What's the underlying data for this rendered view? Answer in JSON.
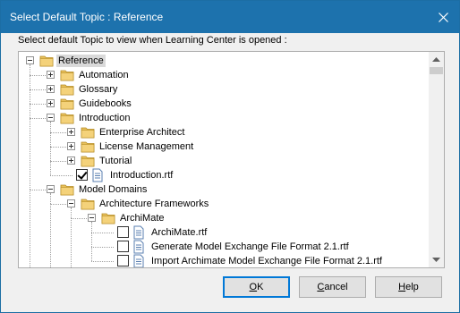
{
  "window": {
    "title": "Select Default Topic : Reference",
    "instruction": "Select default Topic to view when Learning Center is opened :"
  },
  "tree": {
    "items": [
      {
        "label": "Reference",
        "type": "folder",
        "level": 0,
        "expander": "minus",
        "selected": true
      },
      {
        "label": "Automation",
        "type": "folder",
        "level": 1,
        "expander": "plus"
      },
      {
        "label": "Glossary",
        "type": "folder",
        "level": 1,
        "expander": "plus"
      },
      {
        "label": "Guidebooks",
        "type": "folder",
        "level": 1,
        "expander": "plus"
      },
      {
        "label": "Introduction",
        "type": "folder",
        "level": 1,
        "expander": "minus"
      },
      {
        "label": "Enterprise Architect",
        "type": "folder",
        "level": 2,
        "expander": "plus"
      },
      {
        "label": "License Management",
        "type": "folder",
        "level": 2,
        "expander": "plus"
      },
      {
        "label": "Tutorial",
        "type": "folder",
        "level": 2,
        "expander": "plus"
      },
      {
        "label": "Introduction.rtf",
        "type": "doc",
        "level": 2,
        "checked": true
      },
      {
        "label": "Model Domains",
        "type": "folder",
        "level": 1,
        "expander": "minus"
      },
      {
        "label": "Architecture Frameworks",
        "type": "folder",
        "level": 2,
        "expander": "minus"
      },
      {
        "label": "ArchiMate",
        "type": "folder",
        "level": 3,
        "expander": "minus"
      },
      {
        "label": "ArchiMate.rtf",
        "type": "doc",
        "level": 4,
        "checked": false
      },
      {
        "label": "Generate Model Exchange File Format 2.1.rtf",
        "type": "doc",
        "level": 4,
        "checked": false
      },
      {
        "label": "Import Archimate Model Exchange File Format 2.1.rtf",
        "type": "doc",
        "level": 4,
        "checked": false
      }
    ]
  },
  "buttons": {
    "ok_prefix": "",
    "ok_mnemonic": "O",
    "ok_rest": "K",
    "cancel_prefix": "",
    "cancel_mnemonic": "C",
    "cancel_rest": "ancel",
    "help_prefix": "",
    "help_mnemonic": "H",
    "help_rest": "elp"
  },
  "colors": {
    "titlebar": "#1d72ad",
    "folder": "#e8c15c",
    "default_button_border": "#0078d7"
  },
  "icons": {
    "close": "close-icon",
    "folder": "folder-icon",
    "document": "document-icon",
    "scroll_up": "scroll-up-arrow-icon",
    "scroll_down": "scroll-down-arrow-icon"
  }
}
